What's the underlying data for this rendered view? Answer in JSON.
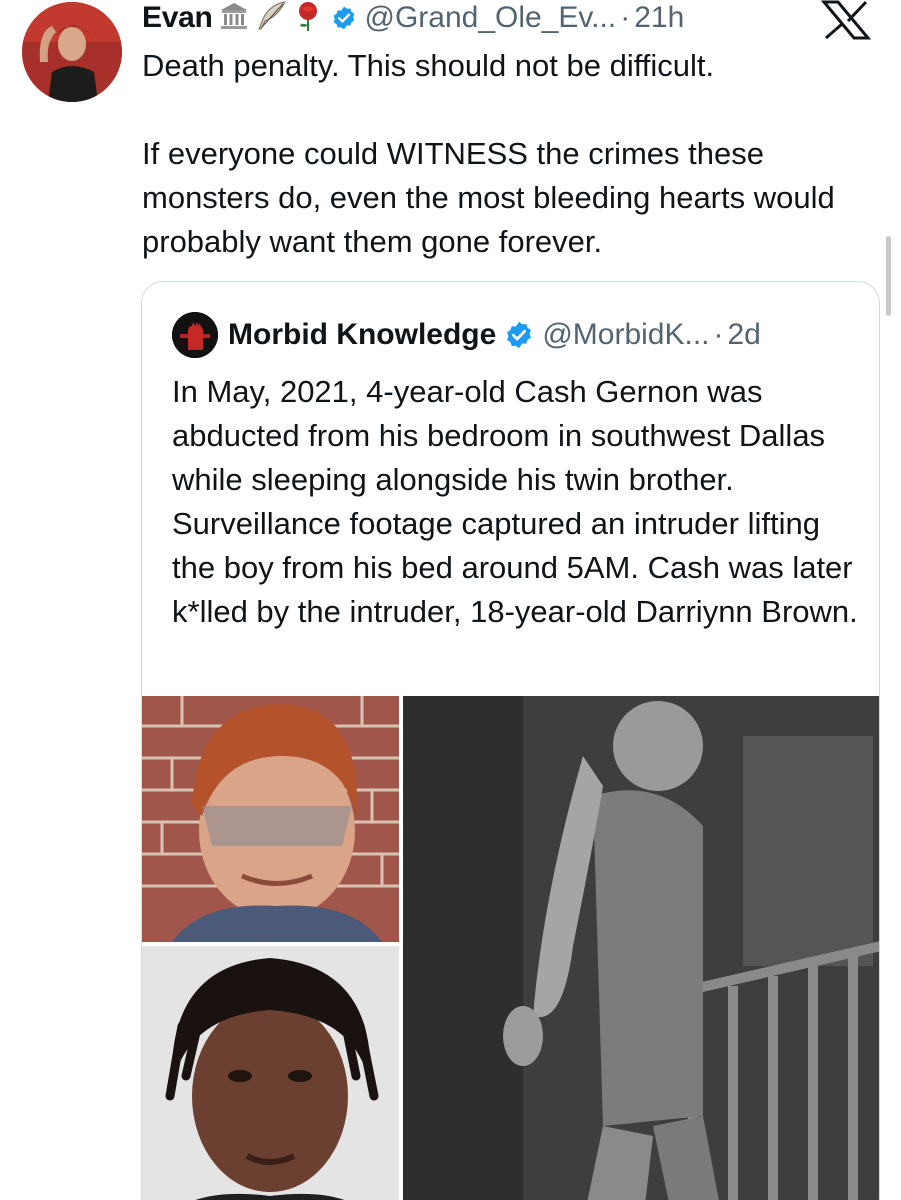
{
  "tweet": {
    "display_name": "Evan",
    "name_emojis": [
      "classical-building-icon",
      "feather-icon",
      "rose-icon"
    ],
    "handle": "@Grand_Ole_Ev...",
    "separator": "·",
    "time": "21h",
    "text_paragraphs": [
      "Death penalty. This should not be difficult.",
      "If everyone could WITNESS the crimes these monsters do, even the most bleeding hearts would probably want them gone forever."
    ]
  },
  "quoted_tweet": {
    "display_name": "Morbid Knowledge",
    "handle": "@MorbidK...",
    "separator": "·",
    "time": "2d",
    "text": "In May, 2021, 4-year-old Cash Gernon was abducted from his bedroom in southwest Dallas while sleeping alongside his twin brother. Surveillance footage captured an intruder lifting the boy from his bed around 5AM. Cash was later k*lled by the intruder, 18-year-old Darriynn Brown.",
    "media": [
      {
        "name": "photo-child-brick-wall"
      },
      {
        "name": "photo-mugshot"
      },
      {
        "name": "photo-surveillance-still"
      }
    ]
  },
  "colors": {
    "text": "#0f1419",
    "secondary": "#536471",
    "verified_blue": "#1d9bf0",
    "border": "#cfd9de"
  }
}
